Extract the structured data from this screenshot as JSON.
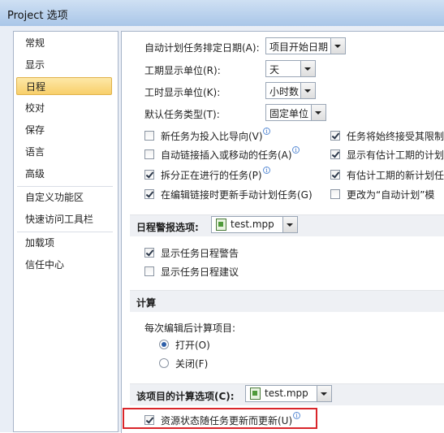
{
  "window": {
    "title": "Project 选项"
  },
  "nav": {
    "items": [
      {
        "label": "常规"
      },
      {
        "label": "显示"
      },
      {
        "label": "日程"
      },
      {
        "label": "校对"
      },
      {
        "label": "保存"
      },
      {
        "label": "语言"
      },
      {
        "label": "高级"
      },
      {
        "label": "自定义功能区"
      },
      {
        "label": "快速访问工具栏"
      },
      {
        "label": "加载项"
      },
      {
        "label": "信任中心"
      }
    ],
    "selected": "日程"
  },
  "schedule": {
    "auto_date_label": "自动计划任务排定日期(A):",
    "auto_date_value": "项目开始日期",
    "duration_unit_label": "工期显示单位(R):",
    "duration_unit_value": "天",
    "work_unit_label": "工时显示单位(K):",
    "work_unit_value": "小时数",
    "task_type_label": "默认任务类型(T):",
    "task_type_value": "固定单位",
    "options_left": [
      {
        "label": "新任务为投入比导向(V)",
        "checked": false
      },
      {
        "label": "自动链接插入或移动的任务(A)",
        "checked": false
      },
      {
        "label": "拆分正在进行的任务(P)",
        "checked": true
      },
      {
        "label": "在编辑链接时更新手动计划任务(G)",
        "checked": true
      }
    ],
    "options_right": [
      {
        "label": "任务将始终接受其限制",
        "checked": true
      },
      {
        "label": "显示有估计工期的计划",
        "checked": true
      },
      {
        "label": "有估计工期的新计划任",
        "checked": true
      },
      {
        "label": "更改为“自动计划”模",
        "checked": false
      }
    ]
  },
  "alerts": {
    "header": "日程警报选项:",
    "file": "test.mpp",
    "options": [
      {
        "label": "显示任务日程警告",
        "checked": true
      },
      {
        "label": "显示任务日程建议",
        "checked": false
      }
    ]
  },
  "calculation": {
    "header": "计算",
    "after_edit_label": "每次编辑后计算项目:",
    "on_label": "打开(O)",
    "off_label": "关闭(F)",
    "selected": "打开(O)"
  },
  "calc_options": {
    "header": "该项目的计算选项(C):",
    "file": "test.mpp",
    "resource_status": {
      "label": "资源状态随任务更新而更新(U)",
      "checked": true
    }
  },
  "colors": {
    "highlight_box": "#d9252a",
    "selected_nav": "#f8cf6a"
  }
}
